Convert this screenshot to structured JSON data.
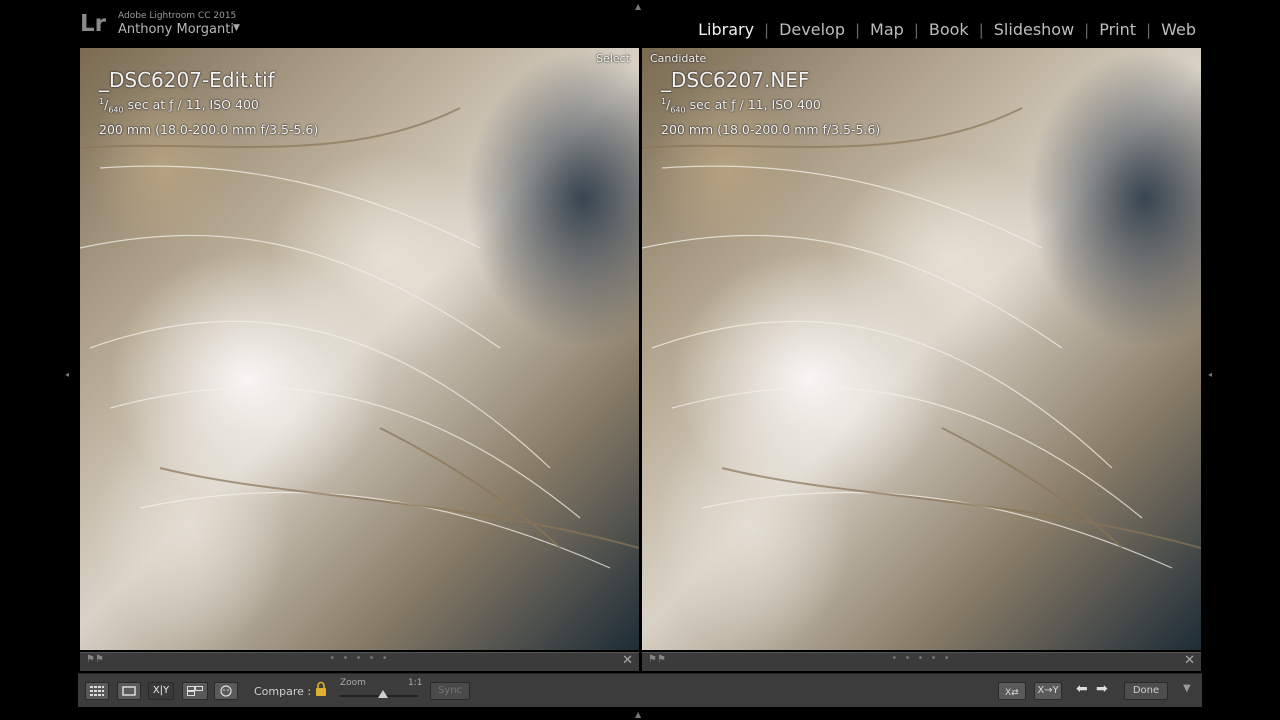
{
  "app": {
    "logo": "Lr",
    "name": "Adobe Lightroom CC 2015",
    "user": "Anthony Morganti"
  },
  "modules": [
    {
      "label": "Library",
      "active": true
    },
    {
      "label": "Develop",
      "active": false
    },
    {
      "label": "Map",
      "active": false
    },
    {
      "label": "Book",
      "active": false
    },
    {
      "label": "Slideshow",
      "active": false
    },
    {
      "label": "Print",
      "active": false
    },
    {
      "label": "Web",
      "active": false
    }
  ],
  "left_pane": {
    "tag": "Select",
    "filename": "_DSC6207-Edit.tif",
    "shutter_num": "1",
    "shutter_den": "640",
    "exposure": " sec at ƒ / 11, ISO 400",
    "lens": "200 mm (18.0-200.0 mm f/3.5-5.6)"
  },
  "right_pane": {
    "tag": "Candidate",
    "filename": "_DSC6207.NEF",
    "shutter_num": "1",
    "shutter_den": "640",
    "exposure": " sec at ƒ / 11, ISO 400",
    "lens": "200 mm (18.0-200.0 mm f/3.5-5.6)"
  },
  "toolbar": {
    "compare_label": "Compare :",
    "zoom_label": "Zoom",
    "zoom_value": "1:1",
    "zoom_level": 0.55,
    "sync_label": "Sync",
    "done_label": "Done",
    "compare_view_label": "X|Y",
    "copy_label": "X→Y"
  },
  "icons": {
    "grid": "grid-icon",
    "loupe": "loupe-icon",
    "survey": "survey-icon",
    "people": "people-icon",
    "lock": "lock-icon",
    "swap": "swap-icon"
  }
}
